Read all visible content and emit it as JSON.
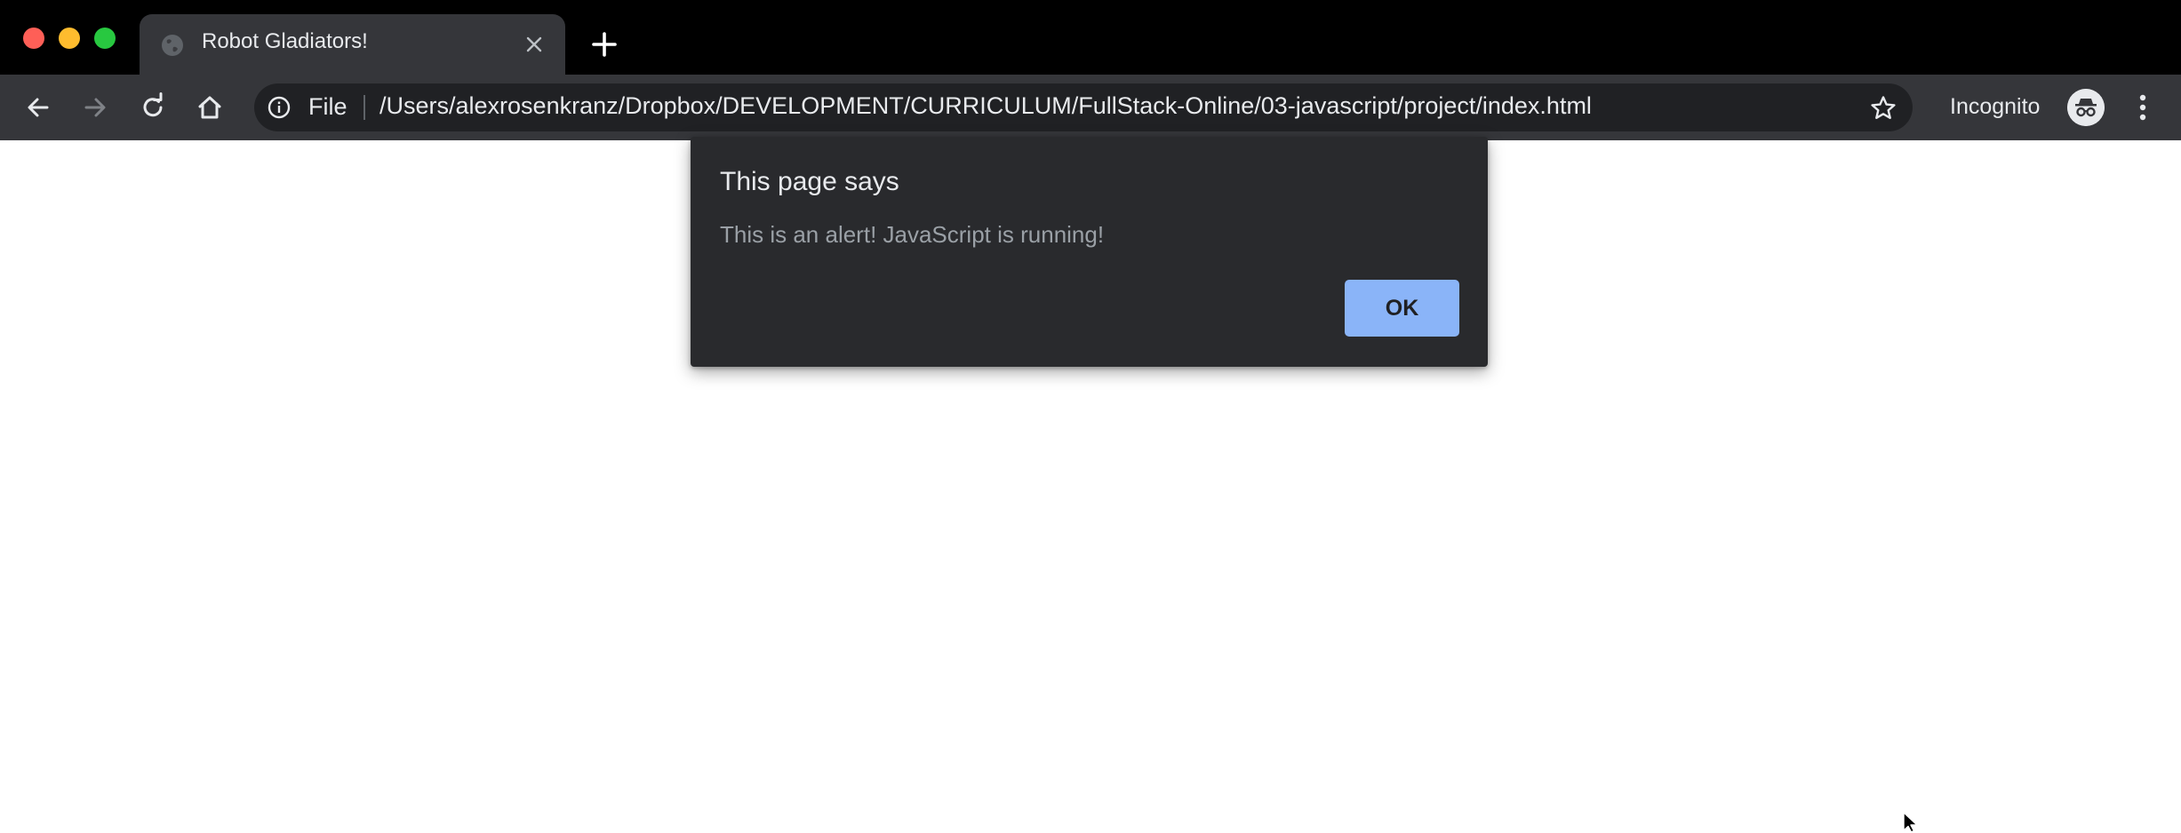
{
  "browser": {
    "tab": {
      "title": "Robot Gladiators!",
      "favicon": "globe-icon",
      "close_icon": "close-icon"
    },
    "new_tab_icon": "plus-icon",
    "toolbar": {
      "back_icon": "back-arrow-icon",
      "forward_icon": "forward-arrow-icon",
      "reload_icon": "reload-icon",
      "home_icon": "home-icon",
      "info_icon": "info-icon",
      "scheme_label": "File",
      "url": "/Users/alexrosenkranz/Dropbox/DEVELOPMENT/CURRICULUM/FullStack-Online/03-javascript/project/index.html",
      "bookmark_icon": "star-icon",
      "profile_label": "Incognito",
      "profile_icon": "incognito-icon",
      "menu_icon": "more-vert-icon"
    },
    "colors": {
      "tab_strip": "#000000",
      "toolbar": "#35363a",
      "omnibox": "#202124",
      "dialog_bg": "#292a2d",
      "button_accent": "#8ab4f8"
    }
  },
  "dialog": {
    "title": "This page says",
    "message": "This is an alert! JavaScript is running!",
    "ok_label": "OK"
  }
}
